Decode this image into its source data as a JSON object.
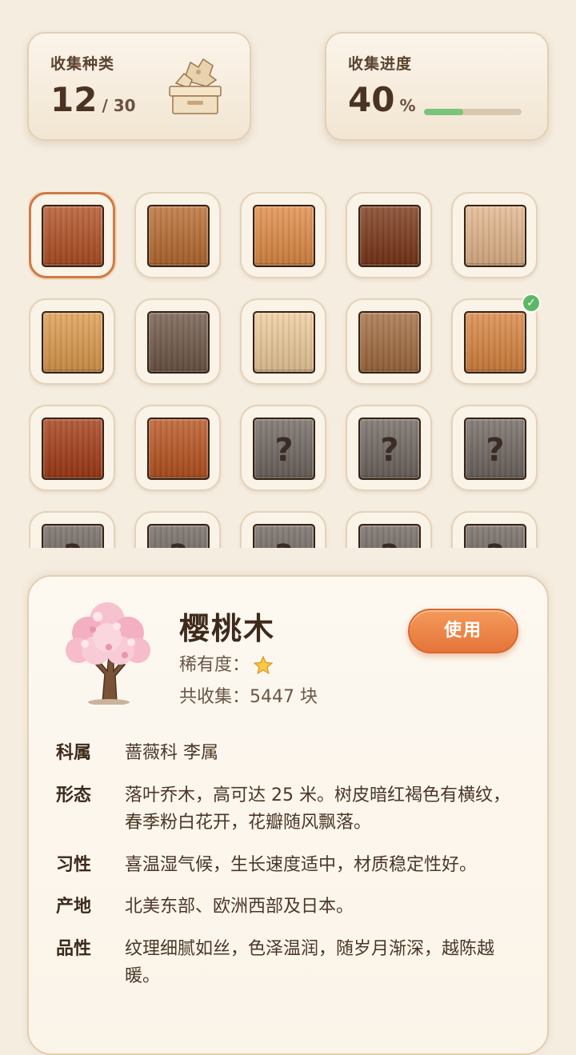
{
  "stats": {
    "species": {
      "title": "收集种类",
      "value": "12",
      "total": "/ 30",
      "icon": "wood-box-icon"
    },
    "progress": {
      "title": "收集进度",
      "value": "40",
      "unit": "%",
      "fraction": 0.4
    }
  },
  "grid": {
    "tiles": [
      {
        "state": "selected",
        "wood": "cherry"
      },
      {
        "state": "owned",
        "wood": "oak"
      },
      {
        "state": "owned",
        "wood": "pine"
      },
      {
        "state": "owned",
        "wood": "walnut"
      },
      {
        "state": "owned",
        "wood": "maple"
      },
      {
        "state": "owned",
        "wood": "knotty-pine"
      },
      {
        "state": "owned",
        "wood": "gray-oak"
      },
      {
        "state": "owned",
        "wood": "birch"
      },
      {
        "state": "owned",
        "wood": "teak"
      },
      {
        "state": "owned-checked",
        "wood": "cedar"
      },
      {
        "state": "owned",
        "wood": "mahogany"
      },
      {
        "state": "owned",
        "wood": "rosewood"
      },
      {
        "state": "locked",
        "label": "?"
      },
      {
        "state": "locked",
        "label": "?"
      },
      {
        "state": "locked",
        "label": "?"
      },
      {
        "state": "locked",
        "label": "?"
      },
      {
        "state": "locked",
        "label": "?"
      },
      {
        "state": "locked",
        "label": "?"
      },
      {
        "state": "locked",
        "label": "?"
      },
      {
        "state": "locked",
        "label": "?"
      }
    ],
    "colors": {
      "cherry": "#b24e22",
      "oak": "#b86a2e",
      "pine": "#e08a44",
      "walnut": "#7a3516",
      "maple": "#e3b58a",
      "knotty-pine": "#dd9a4c",
      "gray-oak": "#6e5646",
      "birch": "#eecb9a",
      "teak": "#a26b3e",
      "cedar": "#d9843f",
      "mahogany": "#a43a14",
      "rosewood": "#b9521e",
      "locked": "#6f6660"
    }
  },
  "detail": {
    "name": "樱桃木",
    "rarity_label": "稀有度：",
    "rarity_stars": 1,
    "total_label": "共收集：",
    "total_value": "5447 块",
    "use_button": "使用",
    "tree_icon": "cherry-blossom-tree-icon",
    "rows": [
      {
        "label": "科属",
        "value": "蔷薇科 李属"
      },
      {
        "label": "形态",
        "value": "落叶乔木，高可达 25 米。树皮暗红褐色有横纹，春季粉白花开，花瓣随风飘落。"
      },
      {
        "label": "习性",
        "value": "喜温湿气候，生长速度适中，材质稳定性好。"
      },
      {
        "label": "产地",
        "value": "北美东部、欧洲西部及日本。"
      },
      {
        "label": "品性",
        "value": "纹理细腻如丝，色泽温润，随岁月渐深，越陈越暖。"
      }
    ]
  }
}
